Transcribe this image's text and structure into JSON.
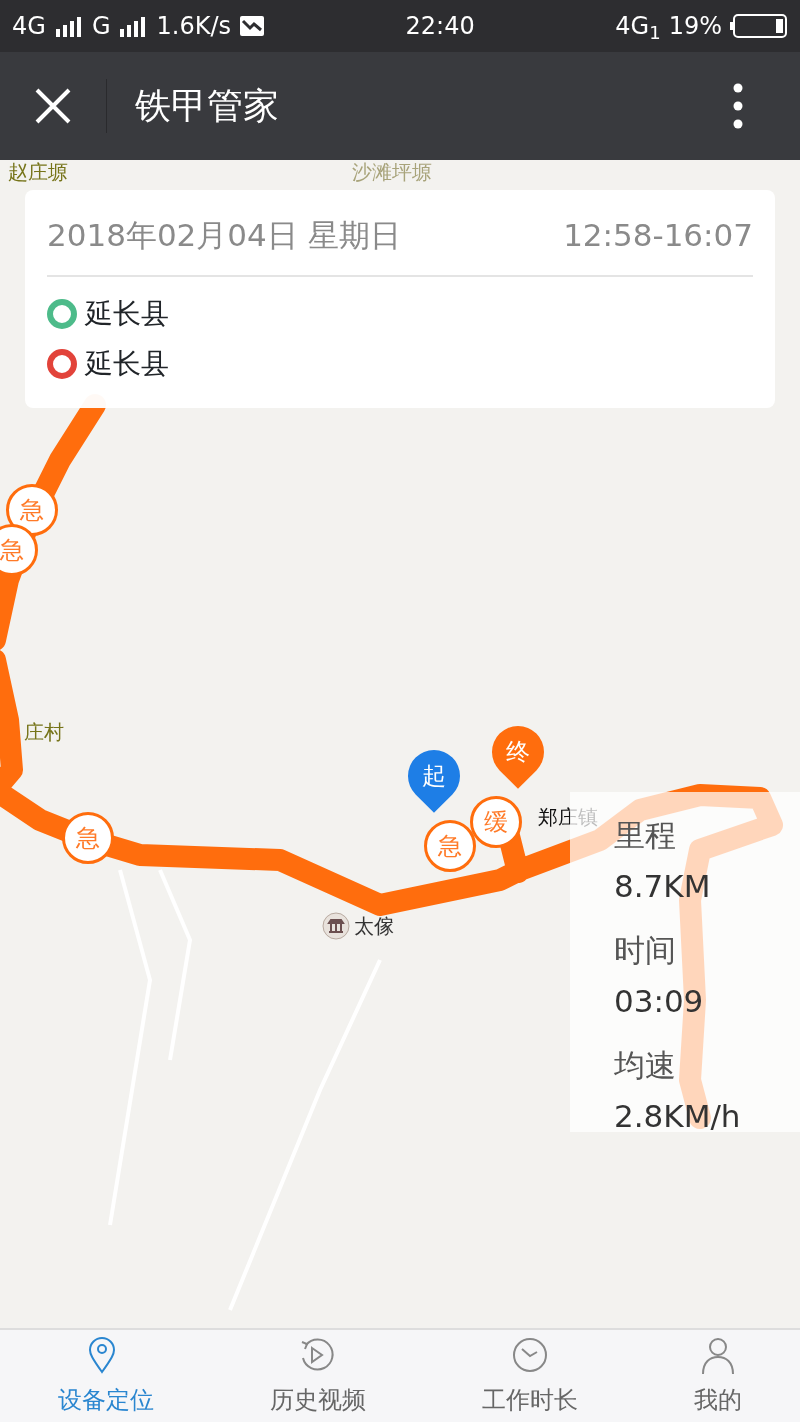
{
  "status_bar": {
    "network_1": "4G",
    "network_2": "G",
    "speed": "1.6K/s",
    "time": "22:40",
    "network_3": "4G$_{1}$",
    "battery": "19%"
  },
  "app_bar": {
    "title": "铁甲管家"
  },
  "map": {
    "labels": [
      {
        "text": "赵庄塬",
        "kind": "village"
      },
      {
        "text": "沙滩坪塬",
        "kind": "faded"
      },
      {
        "text": "庄村",
        "kind": "village"
      },
      {
        "text": "郑庄镇",
        "kind": "town"
      },
      {
        "text": "太傢",
        "kind": "poi"
      }
    ],
    "markers": [
      {
        "text": "急",
        "kind": "alert"
      },
      {
        "text": "急",
        "kind": "alert"
      },
      {
        "text": "急",
        "kind": "alert"
      },
      {
        "text": "终",
        "kind": "end"
      },
      {
        "text": "缓",
        "kind": "alert"
      },
      {
        "text": "急",
        "kind": "alert"
      },
      {
        "text": "起",
        "kind": "start"
      }
    ]
  },
  "trip_card": {
    "date": "2018年02月04日 星期日",
    "time_range": "12:58-16:07",
    "places": [
      {
        "name": "延长县",
        "color": "#4dbb8a"
      },
      {
        "name": "延长县",
        "color": "#e2433a"
      }
    ]
  },
  "stats": [
    {
      "label": "里程",
      "value": "8.7KM"
    },
    {
      "label": "时间",
      "value": "03:09"
    },
    {
      "label": "均速",
      "value": "2.8KM/h"
    }
  ],
  "tabs": [
    {
      "label": "设备定位",
      "selected": true
    },
    {
      "label": "历史视频",
      "selected": false
    },
    {
      "label": "工作时长",
      "selected": false
    },
    {
      "label": "我的",
      "selected": false
    }
  ]
}
